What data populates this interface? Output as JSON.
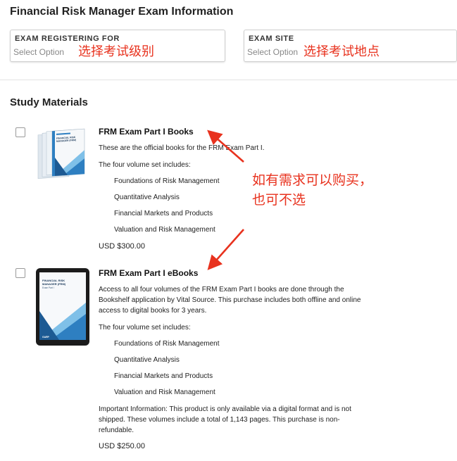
{
  "page": {
    "title": "Financial Risk Manager Exam Information"
  },
  "exam_info": {
    "registering": {
      "label": "EXAM REGISTERING FOR",
      "value": "Select Option",
      "annotation": "选择考试级别"
    },
    "site": {
      "label": "EXAM SITE",
      "value": "Select Option",
      "annotation": "选择考试地点"
    }
  },
  "study": {
    "title": "Study Materials",
    "products": [
      {
        "title": "FRM Exam Part I Books",
        "description": "These are the official books for the FRM Exam Part I.",
        "set_intro": "The four volume set includes:",
        "volumes": [
          "Foundations of Risk Management",
          "Quantitative Analysis",
          "Financial Markets and Products",
          "Valuation and Risk Management"
        ],
        "price": "USD $300.00",
        "cover_lines": [
          "FINANCIAL RISK",
          "MANAGER (FRM)"
        ]
      },
      {
        "title": "FRM Exam Part I eBooks",
        "description_lines": [
          "Access to all four volumes of the FRM Exam Part I books are done through the",
          "Bookshelf application by Vital Source. This purchase includes both offline and online",
          "access to digital books for 3 years."
        ],
        "set_intro": "The four volume set includes:",
        "volumes": [
          "Foundations of Risk Management",
          "Quantitative Analysis",
          "Financial Markets and Products",
          "Valuation and Risk Management"
        ],
        "important_lines": [
          "Important Information: This product is only available via a digital format and is not",
          "shipped. These volumes include a total of 1,143 pages. This purchase is non-",
          "refundable."
        ],
        "price": "USD $250.00",
        "cover_lines": [
          "FINANCIAL RISK",
          "MANAGER (FRM)",
          "Exam Part I"
        ],
        "cover_footer": "GARP"
      }
    ]
  },
  "annotation": {
    "lines": [
      "如有需求可以购买，",
      "也可不选"
    ]
  },
  "colors": {
    "annotation_red": "#e8321e",
    "cover_blue": "#2e7fc1",
    "cover_light": "#7fc0e8",
    "tablet_dark": "#1b1b1b"
  }
}
